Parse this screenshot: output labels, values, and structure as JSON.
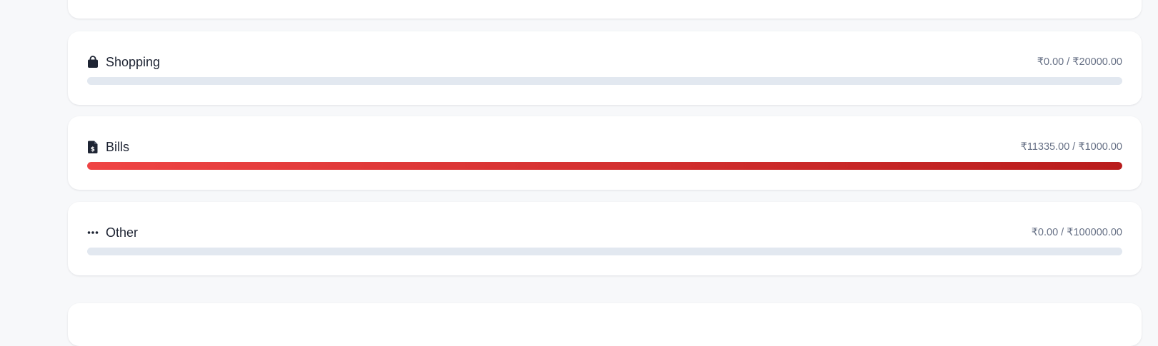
{
  "budgets": [
    {
      "name": "Shopping",
      "icon": "shopping-bag-icon",
      "amount": "₹0.00 / ₹20000.00",
      "progress_percent": 0,
      "bar_color": "#e2e8f0"
    },
    {
      "name": "Bills",
      "icon": "bill-document-icon",
      "amount": "₹11335.00 / ₹1000.00",
      "progress_percent": 100,
      "bar_color": "#dc2626"
    },
    {
      "name": "Other",
      "icon": "more-dots-icon",
      "amount": "₹0.00 / ₹100000.00",
      "progress_percent": 0,
      "bar_color": "#e2e8f0"
    }
  ]
}
